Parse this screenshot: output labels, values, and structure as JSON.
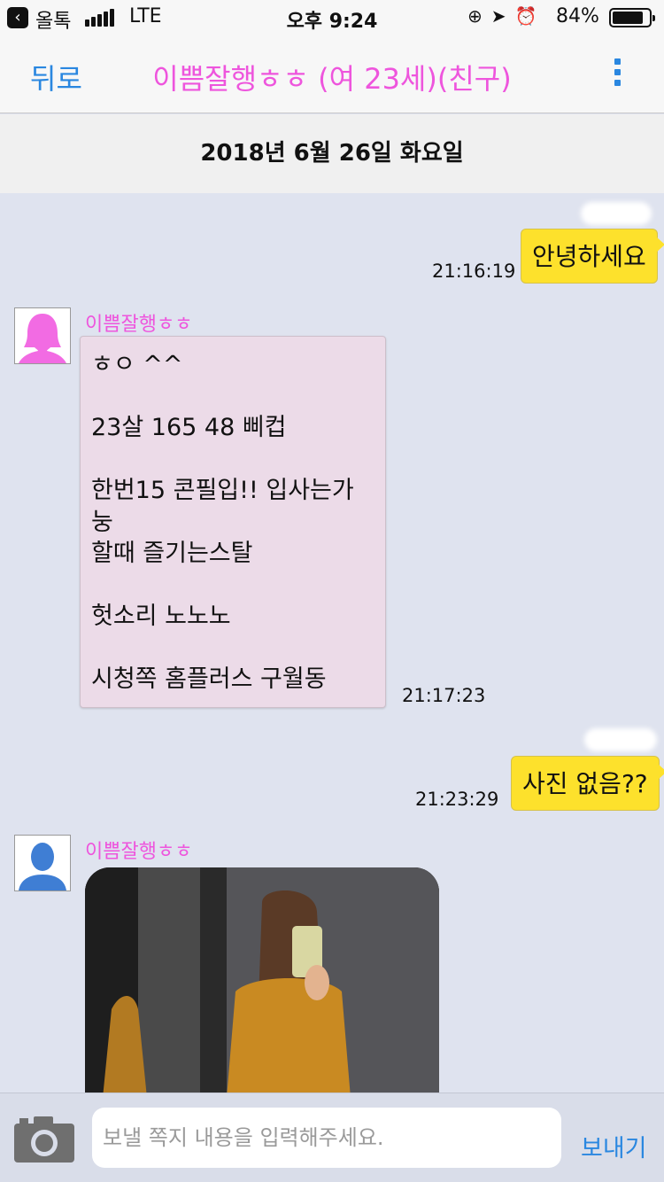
{
  "status_bar": {
    "back_app": "올톡",
    "network": "LTE",
    "time": "오후 9:24",
    "battery_percent": "84%",
    "battery_level": 0.84,
    "icons": [
      "orientation-lock-icon",
      "location-icon",
      "alarm-icon"
    ]
  },
  "nav": {
    "back_label": "뒤로",
    "title": "이쁨잘행ㅎㅎ (여 23세)(친구)",
    "more_icon": "more-vertical-icon"
  },
  "date_header": "2018년 6월 26일 화요일",
  "messages": [
    {
      "direction": "out",
      "text": "안녕하세요",
      "time": "21:16:19"
    },
    {
      "direction": "in",
      "sender": "이쁨잘행ㅎㅎ",
      "avatar": "female-avatar-icon",
      "lines": [
        "ㅎㅇ ^^",
        "23살 165 48 삐컵",
        "한번15 콘필입!! 입사는가눙",
        "할때 즐기는스탈",
        "헛소리 노노노",
        "시청쪽 홈플러스 구월동"
      ],
      "time": "21:17:23"
    },
    {
      "direction": "out",
      "text": "사진 없음??",
      "time": "21:23:29"
    },
    {
      "direction": "in",
      "sender": "이쁨잘행ㅎㅎ",
      "avatar": "male-avatar-icon",
      "type": "photo"
    }
  ],
  "input": {
    "placeholder": "보낼 쪽지 내용을 입력해주세요.",
    "value": "",
    "send_label": "보내기",
    "camera_icon": "camera-icon"
  },
  "colors": {
    "accent_blue": "#2a87e0",
    "name_pink": "#ee55dd",
    "outgoing_bubble": "#fde12c",
    "incoming_bubble": "#ecdbe8",
    "chat_background": "#dfe3ef"
  }
}
